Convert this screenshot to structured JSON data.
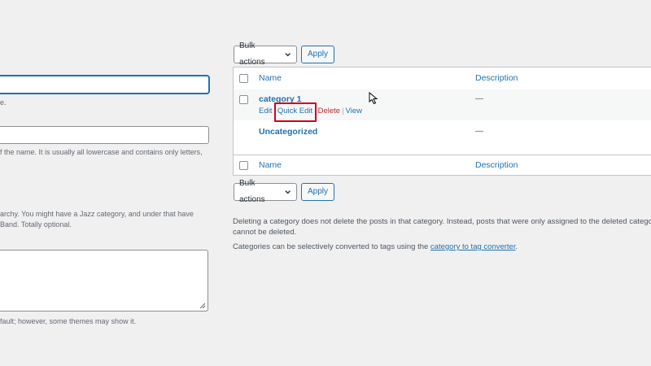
{
  "left_form": {
    "name_hint": "e.",
    "slug_hint": "f the name. It is usually all lowercase and contains only letters,",
    "parent_hint_line1": "archy. You might have a Jazz category, and under that have",
    "parent_hint_line2": "Band. Totally optional.",
    "description_hint": "fault; however, some themes may show it."
  },
  "top_controls": {
    "bulk_label": "Bulk actions",
    "apply_label": "Apply"
  },
  "table": {
    "header": {
      "name": "Name",
      "description": "Description"
    },
    "rows": [
      {
        "name": "category 1",
        "description": "—",
        "actions": {
          "edit": "Edit",
          "quick_edit": "Quick Edit",
          "delete": "Delete",
          "view": "View",
          "sep": "|"
        }
      },
      {
        "name": "Uncategorized",
        "description": "—"
      }
    ],
    "footer": {
      "name": "Name",
      "description": "Description"
    }
  },
  "bottom_controls": {
    "bulk_label": "Bulk actions",
    "apply_label": "Apply"
  },
  "notes": {
    "delete_note_line1": "Deleting a category does not delete the posts in that category. Instead, posts that were only assigned to the deleted category",
    "delete_note_line2": "cannot be deleted.",
    "convert_prefix": "Categories can be selectively converted to tags using the ",
    "convert_link": "category to tag converter",
    "convert_suffix": "."
  },
  "colors": {
    "link": "#2271b1",
    "delete": "#b32d2e",
    "highlight": "#d0021b",
    "background": "#f0f0f1"
  }
}
